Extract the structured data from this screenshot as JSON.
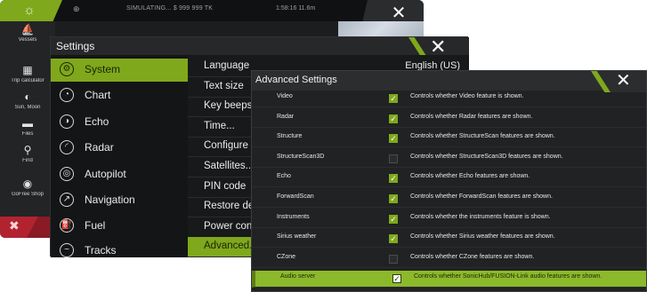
{
  "home": {
    "gps": "⊕",
    "status_sim": "SIMULATING... $ 999 999 TK",
    "time": "1:58:16  11.6m",
    "home_icon": "gear-icon",
    "home_glyph": "☼",
    "close_glyph": "✕",
    "sidebar": [
      {
        "label": "Vessels",
        "icon": "boat-icon",
        "glyph": "⛵"
      },
      {
        "label": "Trip calculator",
        "icon": "trip-calculator-icon",
        "glyph": "▦"
      },
      {
        "label": "Sun, Moon",
        "icon": "sun-moon-icon",
        "glyph": "◐"
      },
      {
        "label": "Files",
        "icon": "folder-icon",
        "glyph": "▬"
      },
      {
        "label": "Find",
        "icon": "search-icon",
        "glyph": "⚲"
      },
      {
        "label": "GoFree Shop",
        "icon": "shop-icon",
        "glyph": "◉"
      }
    ],
    "red_close_glyph": "✖"
  },
  "settings": {
    "title": "Settings",
    "close_glyph": "✕",
    "categories": [
      {
        "label": "System",
        "icon": "gear-icon",
        "glyph": "⚙"
      },
      {
        "label": "Chart",
        "icon": "chart-icon",
        "glyph": "◔"
      },
      {
        "label": "Echo",
        "icon": "echo-icon",
        "glyph": "◑"
      },
      {
        "label": "Radar",
        "icon": "radar-icon",
        "glyph": "◜"
      },
      {
        "label": "Autopilot",
        "icon": "autopilot-icon",
        "glyph": "◎"
      },
      {
        "label": "Navigation",
        "icon": "navigation-icon",
        "glyph": "↗"
      },
      {
        "label": "Fuel",
        "icon": "fuel-icon",
        "glyph": "⛽"
      },
      {
        "label": "Tracks",
        "icon": "tracks-icon",
        "glyph": "~"
      }
    ],
    "items": [
      {
        "label": "Language",
        "value": "English (US)"
      },
      {
        "label": "Text size",
        "value": ""
      },
      {
        "label": "Key beeps",
        "value": ""
      },
      {
        "label": "Time...",
        "value": ""
      },
      {
        "label": "Configure Wi",
        "value": ""
      },
      {
        "label": "Satellites...",
        "value": ""
      },
      {
        "label": "PIN code",
        "value": ""
      },
      {
        "label": "Restore defa",
        "value": ""
      },
      {
        "label": "Power contro",
        "value": ""
      },
      {
        "label": "Advanced...",
        "value": ""
      }
    ]
  },
  "advanced": {
    "title": "Advanced Settings",
    "close_glyph": "✕",
    "rows": [
      {
        "label": "Video",
        "checked": true,
        "desc": "Controls whether Video feature is shown."
      },
      {
        "label": "Radar",
        "checked": true,
        "desc": "Controls whether Radar features are shown."
      },
      {
        "label": "Structure",
        "checked": true,
        "desc": "Controls whether StructureScan features are shown."
      },
      {
        "label": "StructureScan3D",
        "checked": false,
        "desc": "Controls whether StructureScan3D features are shown."
      },
      {
        "label": "Echo",
        "checked": true,
        "desc": "Controls whether Echo features are shown."
      },
      {
        "label": "ForwardScan",
        "checked": true,
        "desc": "Controls whether ForwardScan features are shown."
      },
      {
        "label": "Instruments",
        "checked": true,
        "desc": "Controls whether the instruments feature is shown."
      },
      {
        "label": "Sirius weather",
        "checked": true,
        "desc": "Controls whether Sirius weather features are shown."
      },
      {
        "label": "CZone",
        "checked": false,
        "desc": "Controls whether CZone features are shown."
      },
      {
        "label": "Audio server",
        "checked": true,
        "desc": "Controls whether SonicHub/FUSION-Link audio features are shown.",
        "selected": true
      }
    ]
  },
  "colors": {
    "accent_green": "#7fa81c",
    "selected_row": "#8cb92b",
    "close_red": "#b22330",
    "window_bg": "#202223"
  }
}
